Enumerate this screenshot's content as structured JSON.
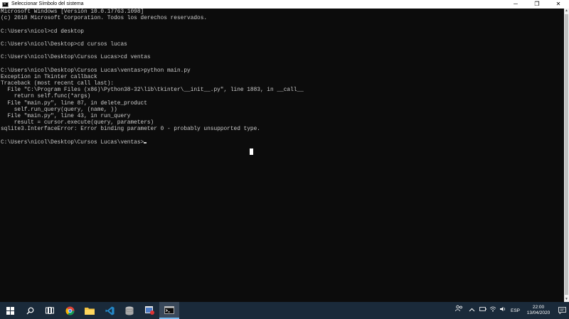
{
  "window": {
    "title": "Seleccionar Símbolo del sistema",
    "controls": {
      "minimize": "─",
      "maximize": "❐",
      "close": "✕"
    }
  },
  "console": {
    "lines": [
      "Microsoft Windows [Versión 10.0.17763.1098]",
      "(c) 2018 Microsoft Corporation. Todos los derechos reservados.",
      "",
      "C:\\Users\\nicol>cd desktop",
      "",
      "C:\\Users\\nicol\\Desktop>cd cursos lucas",
      "",
      "C:\\Users\\nicol\\Desktop\\Cursos Lucas>cd ventas",
      "",
      "C:\\Users\\nicol\\Desktop\\Cursos Lucas\\ventas>python main.py",
      "Exception in Tkinter callback",
      "Traceback (most recent call last):",
      "  File \"C:\\Program Files (x86)\\Python38-32\\lib\\tkinter\\__init__.py\", line 1883, in __call__",
      "    return self.func(*args)",
      "  File \"main.py\", line 87, in delete_product",
      "    self.run_query(query, (name, ))",
      "  File \"main.py\", line 43, in run_query",
      "    result = cursor.execute(query, parameters)",
      "sqlite3.InterfaceError: Error binding parameter 0 - probably unsupported type.",
      "",
      "C:\\Users\\nicol\\Desktop\\Cursos Lucas\\ventas>"
    ]
  },
  "taskbar": {
    "apps": [
      "windows-start-icon",
      "search-icon",
      "task-view-icon",
      "chrome-icon",
      "file-explorer-icon",
      "vscode-icon",
      "database-icon",
      "app-icon",
      "terminal-icon"
    ],
    "language": "ESP",
    "time": "22:00",
    "date": "13/04/2020"
  },
  "colors": {
    "console_bg": "#0c0c0c",
    "console_text": "#cccccc",
    "taskbar_bg": "#1a2a3a",
    "accent": "#76b9ed"
  }
}
